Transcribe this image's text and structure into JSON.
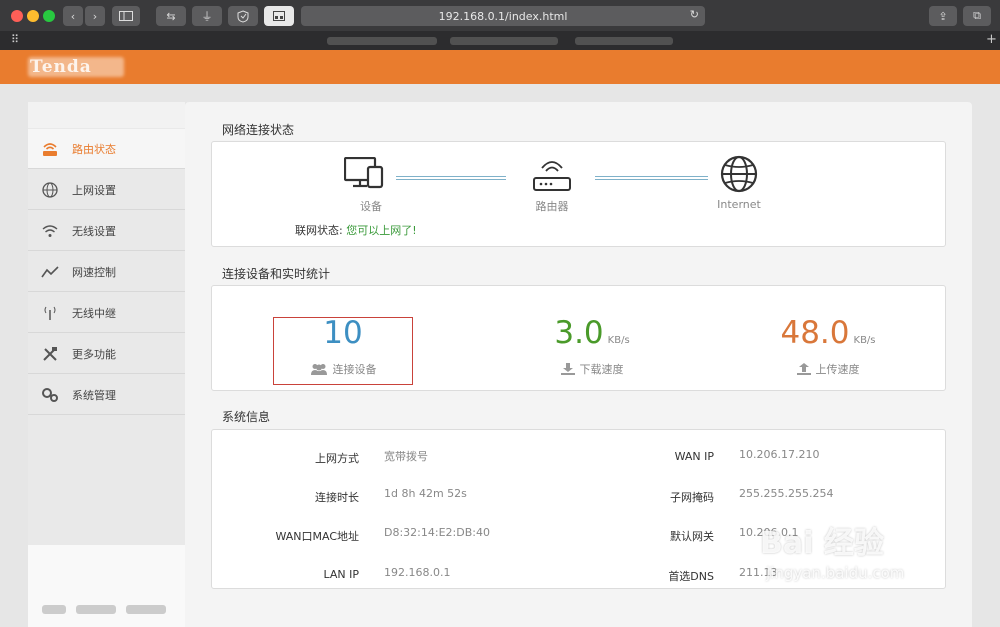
{
  "browser": {
    "url": "192.168.0.1/index.html",
    "reload_icon": "reload-icon"
  },
  "brand": {
    "logo": "Tenda"
  },
  "sidebar": {
    "items": [
      {
        "label": "路由状态",
        "icon": "router-icon",
        "active": true
      },
      {
        "label": "上网设置",
        "icon": "globe-icon"
      },
      {
        "label": "无线设置",
        "icon": "wifi-icon"
      },
      {
        "label": "网速控制",
        "icon": "speed-icon"
      },
      {
        "label": "无线中继",
        "icon": "antenna-icon"
      },
      {
        "label": "更多功能",
        "icon": "tools-icon"
      },
      {
        "label": "系统管理",
        "icon": "gear-icon"
      }
    ]
  },
  "network": {
    "title": "网络连接状态",
    "device_label": "设备",
    "router_label": "路由器",
    "internet_label": "Internet",
    "status_label": "联网状态:",
    "status_value": "您可以上网了!",
    "status_color": "#3a9a3a"
  },
  "stats": {
    "title": "连接设备和实时统计",
    "devices": {
      "value": "10",
      "label": "连接设备",
      "color": "#3d8fc2"
    },
    "download": {
      "value": "3.0",
      "unit": "KB/s",
      "label": "下载速度",
      "color": "#4a9a2a"
    },
    "upload": {
      "value": "48.0",
      "unit": "KB/s",
      "label": "上传速度",
      "color": "#d9773a"
    }
  },
  "sysinfo": {
    "title": "系统信息",
    "left": [
      {
        "label": "上网方式",
        "value": "宽带拨号"
      },
      {
        "label": "连接时长",
        "value": "1d 8h 42m 52s"
      },
      {
        "label": "WAN口MAC地址",
        "value": "D8:32:14:E2:DB:40"
      },
      {
        "label": "LAN IP",
        "value": "192.168.0.1"
      }
    ],
    "right": [
      {
        "label": "WAN IP",
        "value": "10.206.17.210"
      },
      {
        "label": "子网掩码",
        "value": "255.255.255.254"
      },
      {
        "label": "默认网关",
        "value": "10.206.0.1"
      },
      {
        "label": "首选DNS",
        "value": "211.13"
      }
    ]
  },
  "watermark": {
    "main": "Bai 经验",
    "sub": "jingyan.baidu.com"
  }
}
